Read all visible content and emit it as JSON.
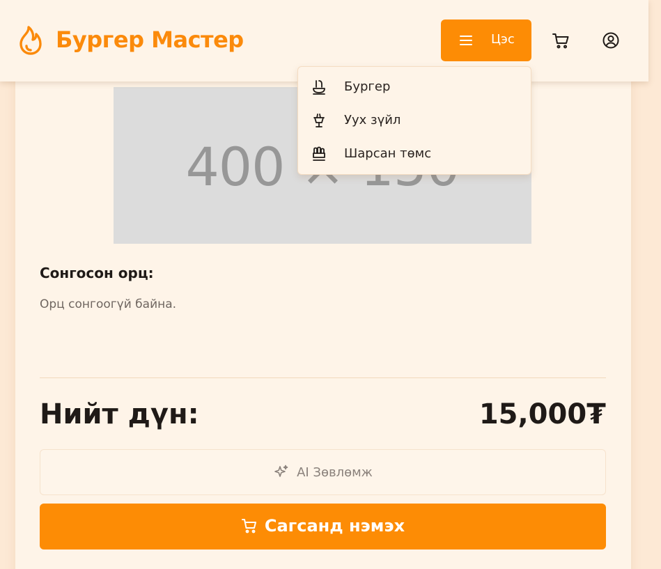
{
  "header": {
    "brand": "Бургер Мастер",
    "menu_label": "Цэс",
    "cart_icon": "cart-icon",
    "user_icon": "user-circle-icon"
  },
  "dropdown": {
    "items": [
      {
        "label": "Бургер",
        "icon": "burger-icon"
      },
      {
        "label": "Уух зүйл",
        "icon": "drink-icon"
      },
      {
        "label": "Шарсан төмс",
        "icon": "fries-icon"
      }
    ]
  },
  "image_placeholder": {
    "text": "400 × 150"
  },
  "selection": {
    "title": "Сонгосон орц:",
    "empty_text": "Орц сонгоогүй байна."
  },
  "total": {
    "label": "Нийт дүн:",
    "value": "15,000₮"
  },
  "ai_button": {
    "label": "AI Зөвлөмж",
    "icon": "sparkles-icon"
  },
  "add_button": {
    "label": "Сагсанд нэмэх",
    "icon": "cart-icon"
  },
  "colors": {
    "accent": "#fd8c05",
    "background": "#fef4e8",
    "page": "#fde9d5"
  }
}
